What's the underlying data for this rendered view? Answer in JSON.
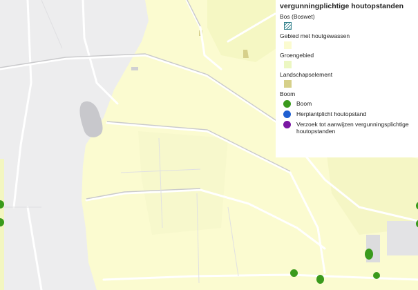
{
  "legend": {
    "title": "vergunningplichtige houtopstanden",
    "sections": [
      {
        "label": "Bos (Boswet)",
        "swatch": "hatch",
        "color": "#2f7f8a"
      },
      {
        "label": "Gebied met houtgewassen",
        "swatch": "fill",
        "color": "#fbfbd0"
      },
      {
        "label": "Groengebied",
        "swatch": "fill",
        "color": "#ecf7c2"
      },
      {
        "label": "Landschapselement",
        "swatch": "fill",
        "color": "#d6d08a"
      }
    ],
    "boom_group": {
      "label": "Boom",
      "items": [
        {
          "label": "Boom",
          "color": "#3a9a1c"
        },
        {
          "label": "Herplantplicht houtopstand",
          "color": "#1f5fd1"
        },
        {
          "label": "Verzoek tot aanwijzen vergunningsplichtige houtopstanden",
          "color": "#7a17a3"
        }
      ]
    }
  },
  "map": {
    "colors": {
      "background": "#ededee",
      "woodland_area": "#fbfbd0",
      "green_area": "#f5f7c7",
      "landscape_element": "#d6d08a",
      "water": "#c8c8cc",
      "road": "#ffffff",
      "tree": "#3a9a1c"
    }
  }
}
